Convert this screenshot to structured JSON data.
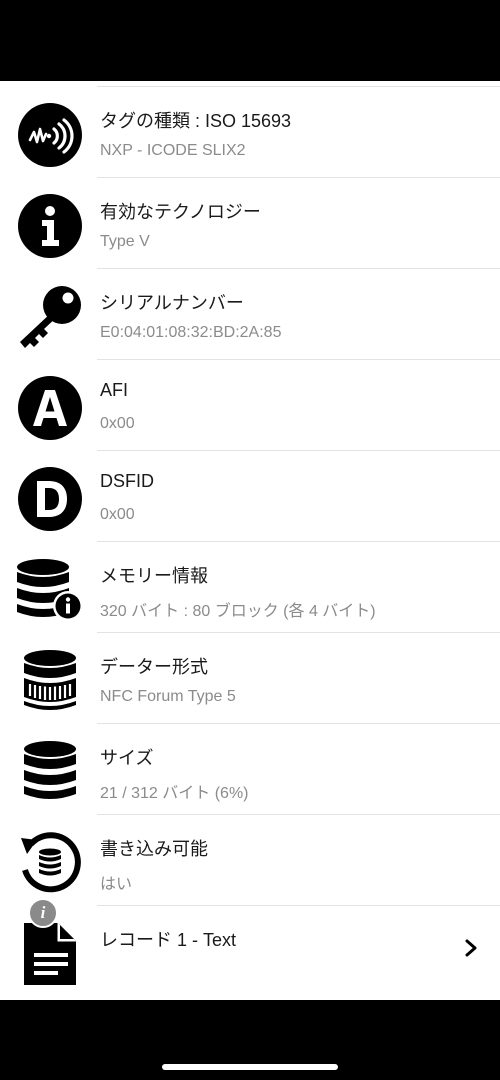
{
  "items": [
    {
      "title": "タグの種類 : ISO 15693",
      "subtitle": "NXP - ICODE SLIX2",
      "icon": "nfc-signal-icon"
    },
    {
      "title": "有効なテクノロジー",
      "subtitle": "Type V",
      "icon": "info-icon"
    },
    {
      "title": "シリアルナンバー",
      "subtitle": "E0:04:01:08:32:BD:2A:85",
      "icon": "key-icon"
    },
    {
      "title": "AFI",
      "subtitle": "0x00",
      "icon": "letter-a-icon"
    },
    {
      "title": "DSFID",
      "subtitle": "0x00",
      "icon": "letter-d-icon"
    },
    {
      "title": "メモリー情報",
      "subtitle": "320 バイト : 80 ブロック (各 4 バイト)",
      "icon": "database-info-icon"
    },
    {
      "title": "データー形式",
      "subtitle": "NFC Forum Type 5",
      "icon": "database-format-icon"
    },
    {
      "title": "サイズ",
      "subtitle": "21 / 312 バイト (6%)",
      "icon": "database-icon"
    },
    {
      "title": "書き込み可能",
      "subtitle": "はい",
      "icon": "database-refresh-icon"
    },
    {
      "title": "レコード 1 - Text",
      "subtitle": "",
      "icon": "document-icon"
    }
  ],
  "info_badge": "i",
  "colors": {
    "background": "#000000",
    "list_background": "#ffffff",
    "title": "#1a1a1a",
    "subtitle": "#8b8b8b",
    "divider": "#e3e3e3"
  }
}
